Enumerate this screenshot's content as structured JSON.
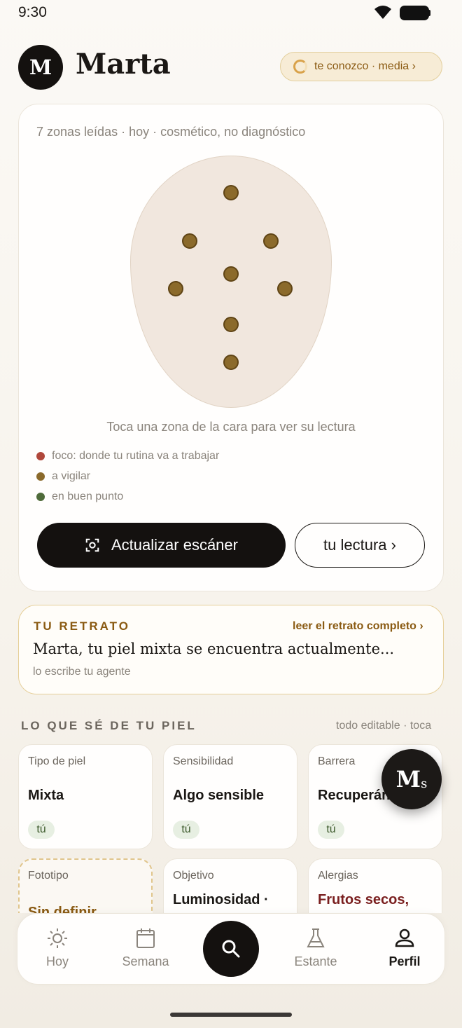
{
  "status_bar": {
    "time": "9:30"
  },
  "header": {
    "avatar_initial": "M",
    "name": "Marta",
    "knowledge_pill": "te conozco · media ›"
  },
  "scan": {
    "zones_note": "7 zonas leídas · hoy · cosmético, no diagnóstico",
    "tap_hint": "Toca una zona de la cara para ver su lectura",
    "legend": [
      {
        "label": "foco: donde tu rutina va a trabajar",
        "color": "#b0473b"
      },
      {
        "label": "a vigilar",
        "color": "#8b6a2b"
      },
      {
        "label": "en buen punto",
        "color": "#4f6b3a"
      }
    ],
    "update_button": "Actualizar escáner",
    "reading_button": "tu lectura ›",
    "zone_color": "#8b6a2b"
  },
  "portrait": {
    "kicker": "TU RETRATO",
    "link": "leer el retrato completo ›",
    "text": "Marta, tu piel mixta se encuentra actualmente...",
    "sub": "lo escribe tu agente"
  },
  "skin": {
    "title": "LO QUE SÉ DE TU PIEL",
    "meta": "todo editable · toca",
    "traits": [
      {
        "label": "Tipo de piel",
        "value": "Mixta",
        "tag": "tú"
      },
      {
        "label": "Sensibilidad",
        "value": "Algo sensible",
        "tag": "tú"
      },
      {
        "label": "Barrera",
        "value": "Recuperán",
        "tag": "tú"
      },
      {
        "label": "Fototipo",
        "value": "Sin definir"
      },
      {
        "label": "Objetivo",
        "value": "Luminosidad ·"
      },
      {
        "label": "Alergias",
        "value": "Frutos secos,"
      }
    ]
  },
  "fab": {
    "m": "M",
    "s": "s"
  },
  "nav": {
    "items": [
      {
        "label": "Hoy",
        "icon": "sun-icon"
      },
      {
        "label": "Semana",
        "icon": "calendar-icon"
      },
      {
        "label": "Estante",
        "icon": "flask-icon"
      },
      {
        "label": "Perfil",
        "icon": "person-icon"
      }
    ],
    "active": "Perfil"
  }
}
